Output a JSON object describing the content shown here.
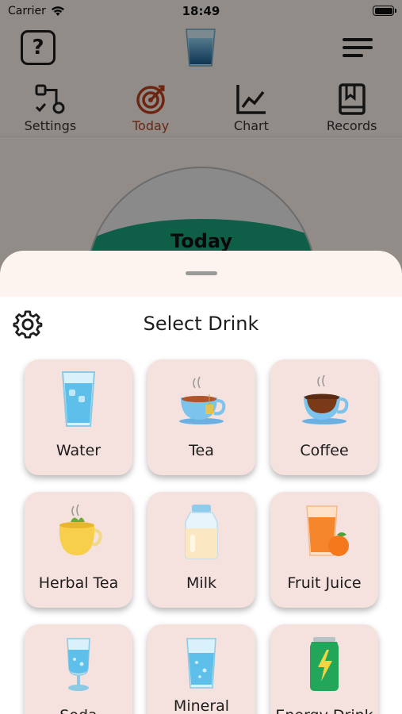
{
  "status_bar": {
    "carrier": "Carrier",
    "time": "18:49"
  },
  "header": {
    "help_glyph": "?",
    "logo_icon": "water-glass-icon",
    "menu_icon": "menu-icon"
  },
  "tabs": [
    {
      "label": "Settings",
      "icon": "settings-flow-icon",
      "active": false
    },
    {
      "label": "Today",
      "icon": "target-icon",
      "active": true
    },
    {
      "label": "Chart",
      "icon": "line-chart-icon",
      "active": false
    },
    {
      "label": "Records",
      "icon": "bookmark-book-icon",
      "active": false
    }
  ],
  "today_panel": {
    "label": "Today"
  },
  "sheet": {
    "title": "Select Drink",
    "settings_icon": "gear-icon",
    "drinks": [
      {
        "label": "Water",
        "icon": "water-glass-icon"
      },
      {
        "label": "Tea",
        "icon": "tea-cup-icon"
      },
      {
        "label": "Coffee",
        "icon": "coffee-cup-icon"
      },
      {
        "label": "Herbal Tea",
        "icon": "herbal-tea-icon"
      },
      {
        "label": "Milk",
        "icon": "milk-bottle-icon"
      },
      {
        "label": "Fruit Juice",
        "icon": "fruit-juice-icon"
      },
      {
        "label": "Soda",
        "icon": "soda-glass-icon"
      },
      {
        "label": "Mineral",
        "icon": "mineral-water-icon"
      },
      {
        "label": "Energy Drink",
        "icon": "energy-drink-can-icon"
      }
    ]
  },
  "colors": {
    "accent": "#b8401c",
    "card_bg": "#f5e1dd",
    "sheet_bg": "#fdf3ef",
    "wave": "#1aa37c"
  }
}
